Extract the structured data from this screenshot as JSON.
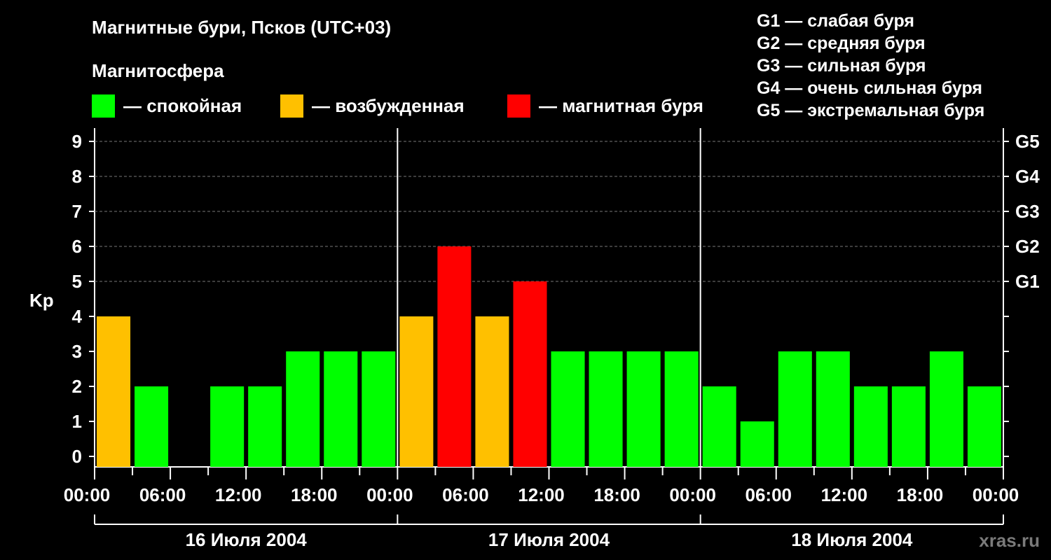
{
  "title": "Магнитные бури, Псков (UTC+03)",
  "subtitle": "Магнитосфера",
  "legend": [
    {
      "label": "— спокойная",
      "color": "#00ff00"
    },
    {
      "label": "— возбужденная",
      "color": "#ffc000"
    },
    {
      "label": "— магнитная буря",
      "color": "#ff0000"
    }
  ],
  "g_scale": [
    "G1 — слабая буря",
    "G2 — средняя буря",
    "G3 — сильная буря",
    "G4 — очень сильная буря",
    "G5 — экстремальная буря"
  ],
  "watermark": "xras.ru",
  "chart_data": {
    "type": "bar",
    "ylabel": "Kp",
    "ylim": [
      0,
      9
    ],
    "y_ticks": [
      0,
      1,
      2,
      3,
      4,
      5,
      6,
      7,
      8,
      9
    ],
    "right_axis_labels": [
      {
        "value": 5,
        "label": "G1"
      },
      {
        "value": 6,
        "label": "G2"
      },
      {
        "value": 7,
        "label": "G3"
      },
      {
        "value": 8,
        "label": "G4"
      },
      {
        "value": 9,
        "label": "G5"
      }
    ],
    "x_tick_labels": [
      "00:00",
      "06:00",
      "12:00",
      "18:00",
      "00:00",
      "06:00",
      "12:00",
      "18:00",
      "00:00",
      "06:00",
      "12:00",
      "18:00",
      "00:00"
    ],
    "days": [
      "16 Июля 2004",
      "17 Июля 2004",
      "18 Июля 2004"
    ],
    "interval_hours": 3,
    "values": [
      4,
      2,
      0,
      2,
      2,
      3,
      3,
      3,
      4,
      6,
      4,
      5,
      3,
      3,
      3,
      3,
      2,
      1,
      3,
      3,
      2,
      2,
      3,
      2
    ],
    "colors": {
      "quiet": "#00ff00",
      "active": "#ffc000",
      "storm": "#ff0000"
    },
    "grid": true
  }
}
